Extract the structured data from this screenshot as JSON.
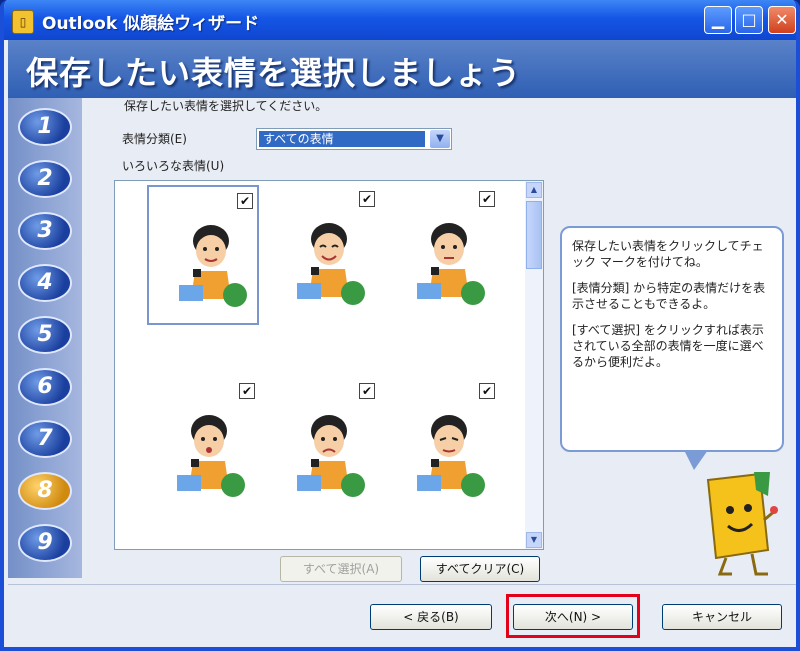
{
  "window": {
    "title": "Outlook 似顔絵ウィザード",
    "title_icon_glyph": "▯",
    "minimize_glyph": "▁",
    "maximize_glyph": "□",
    "close_glyph": "✕"
  },
  "header": {
    "title": "保存したい表情を選択しましょう"
  },
  "steps": [
    "1",
    "2",
    "3",
    "4",
    "5",
    "6",
    "7",
    "8",
    "9"
  ],
  "active_step": "8",
  "intro_text": "保存したい表情を選択してください。",
  "category": {
    "label": "表情分類(E)",
    "selected": "すべての表情",
    "arrow_glyph": "▼"
  },
  "list": {
    "label": "いろいろな表情(U)",
    "items": [
      {
        "checked": true,
        "check_glyph": "✔"
      },
      {
        "checked": true,
        "check_glyph": "✔"
      },
      {
        "checked": true,
        "check_glyph": "✔"
      },
      {
        "checked": true,
        "check_glyph": "✔"
      },
      {
        "checked": true,
        "check_glyph": "✔"
      },
      {
        "checked": true,
        "check_glyph": "✔"
      }
    ],
    "scroll_up_glyph": "▲",
    "scroll_down_glyph": "▼"
  },
  "help": {
    "para1": "保存したい表情をクリックしてチェック マークを付けてね。",
    "para2": "[表情分類] から特定の表情だけを表示させることもできるよ。",
    "para3": "[すべて選択] をクリックすれば表示されている全部の表情を一度に選べるから便利だよ。"
  },
  "buttons": {
    "select_all": "すべて選択(A)",
    "clear_all": "すべてクリア(C)",
    "back": "< 戻る(B)",
    "next": "次へ(N) >",
    "cancel": "キャンセル"
  },
  "colors": {
    "title_bar": "#1556e6",
    "header": "#3f6cbd",
    "highlight": "#e3001b",
    "selection": "#316ac5"
  }
}
